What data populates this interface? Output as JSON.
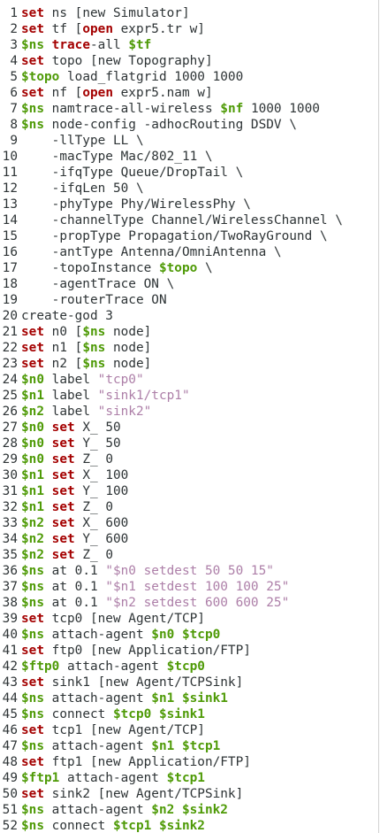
{
  "colors": {
    "keyword": "#a40000",
    "variable": "#4e9a06",
    "string": "#ad7fa8",
    "text": "#2e3436",
    "background": "#ffffff"
  },
  "lines": [
    {
      "n": "1",
      "tokens": [
        {
          "t": "set",
          "c": "kw"
        },
        {
          "t": " ns [new Simulator]",
          "c": ""
        }
      ]
    },
    {
      "n": "2",
      "tokens": [
        {
          "t": "set",
          "c": "kw"
        },
        {
          "t": " tf [",
          "c": ""
        },
        {
          "t": "open",
          "c": "kw"
        },
        {
          "t": " expr5.tr w]",
          "c": ""
        }
      ]
    },
    {
      "n": "3",
      "tokens": [
        {
          "t": "$ns",
          "c": "var"
        },
        {
          "t": " ",
          "c": ""
        },
        {
          "t": "trace",
          "c": "kw"
        },
        {
          "t": "-all ",
          "c": ""
        },
        {
          "t": "$tf",
          "c": "var"
        }
      ]
    },
    {
      "n": "4",
      "tokens": [
        {
          "t": "set",
          "c": "kw"
        },
        {
          "t": " topo [new Topography]",
          "c": ""
        }
      ]
    },
    {
      "n": "5",
      "tokens": [
        {
          "t": "$topo",
          "c": "var"
        },
        {
          "t": " load_flatgrid 1000 1000",
          "c": ""
        }
      ]
    },
    {
      "n": "6",
      "tokens": [
        {
          "t": "set",
          "c": "kw"
        },
        {
          "t": " nf [",
          "c": ""
        },
        {
          "t": "open",
          "c": "kw"
        },
        {
          "t": " expr5.nam w]",
          "c": ""
        }
      ]
    },
    {
      "n": "7",
      "tokens": [
        {
          "t": "$ns",
          "c": "var"
        },
        {
          "t": " namtrace-all-wireless ",
          "c": ""
        },
        {
          "t": "$nf",
          "c": "var"
        },
        {
          "t": " 1000 1000",
          "c": ""
        }
      ]
    },
    {
      "n": "8",
      "tokens": [
        {
          "t": "$ns",
          "c": "var"
        },
        {
          "t": " node-config -adhocRouting DSDV \\",
          "c": ""
        }
      ]
    },
    {
      "n": "9",
      "tokens": [
        {
          "t": "    -llType LL \\",
          "c": ""
        }
      ]
    },
    {
      "n": "10",
      "tokens": [
        {
          "t": "    -macType Mac/802_11 \\",
          "c": ""
        }
      ]
    },
    {
      "n": "11",
      "tokens": [
        {
          "t": "    -ifqType Queue/DropTail \\",
          "c": ""
        }
      ]
    },
    {
      "n": "12",
      "tokens": [
        {
          "t": "    -ifqLen 50 \\",
          "c": ""
        }
      ]
    },
    {
      "n": "13",
      "tokens": [
        {
          "t": "    -phyType Phy/WirelessPhy \\",
          "c": ""
        }
      ]
    },
    {
      "n": "14",
      "tokens": [
        {
          "t": "    -channelType Channel/WirelessChannel \\",
          "c": ""
        }
      ]
    },
    {
      "n": "15",
      "tokens": [
        {
          "t": "    -propType Propagation/TwoRayGround \\",
          "c": ""
        }
      ]
    },
    {
      "n": "16",
      "tokens": [
        {
          "t": "    -antType Antenna/OmniAntenna \\",
          "c": ""
        }
      ]
    },
    {
      "n": "17",
      "tokens": [
        {
          "t": "    -topoInstance ",
          "c": ""
        },
        {
          "t": "$topo",
          "c": "var"
        },
        {
          "t": " \\",
          "c": ""
        }
      ]
    },
    {
      "n": "18",
      "tokens": [
        {
          "t": "    -agentTrace ON \\",
          "c": ""
        }
      ]
    },
    {
      "n": "19",
      "tokens": [
        {
          "t": "    -routerTrace ON",
          "c": ""
        }
      ]
    },
    {
      "n": "20",
      "tokens": [
        {
          "t": "create-god 3",
          "c": ""
        }
      ]
    },
    {
      "n": "21",
      "tokens": [
        {
          "t": "set",
          "c": "kw"
        },
        {
          "t": " n0 [",
          "c": ""
        },
        {
          "t": "$ns",
          "c": "var"
        },
        {
          "t": " node]",
          "c": ""
        }
      ]
    },
    {
      "n": "22",
      "tokens": [
        {
          "t": "set",
          "c": "kw"
        },
        {
          "t": " n1 [",
          "c": ""
        },
        {
          "t": "$ns",
          "c": "var"
        },
        {
          "t": " node]",
          "c": ""
        }
      ]
    },
    {
      "n": "23",
      "tokens": [
        {
          "t": "set",
          "c": "kw"
        },
        {
          "t": " n2 [",
          "c": ""
        },
        {
          "t": "$ns",
          "c": "var"
        },
        {
          "t": " node]",
          "c": ""
        }
      ]
    },
    {
      "n": "24",
      "tokens": [
        {
          "t": "$n0",
          "c": "var"
        },
        {
          "t": " label ",
          "c": ""
        },
        {
          "t": "\"tcp0\"",
          "c": "str"
        }
      ]
    },
    {
      "n": "25",
      "tokens": [
        {
          "t": "$n1",
          "c": "var"
        },
        {
          "t": " label ",
          "c": ""
        },
        {
          "t": "\"sink1/tcp1\"",
          "c": "str"
        }
      ]
    },
    {
      "n": "26",
      "tokens": [
        {
          "t": "$n2",
          "c": "var"
        },
        {
          "t": " label ",
          "c": ""
        },
        {
          "t": "\"sink2\"",
          "c": "str"
        }
      ]
    },
    {
      "n": "27",
      "tokens": [
        {
          "t": "$n0",
          "c": "var"
        },
        {
          "t": " ",
          "c": ""
        },
        {
          "t": "set",
          "c": "kw"
        },
        {
          "t": " X_ 50",
          "c": ""
        }
      ]
    },
    {
      "n": "28",
      "tokens": [
        {
          "t": "$n0",
          "c": "var"
        },
        {
          "t": " ",
          "c": ""
        },
        {
          "t": "set",
          "c": "kw"
        },
        {
          "t": " Y_ 50",
          "c": ""
        }
      ]
    },
    {
      "n": "29",
      "tokens": [
        {
          "t": "$n0",
          "c": "var"
        },
        {
          "t": " ",
          "c": ""
        },
        {
          "t": "set",
          "c": "kw"
        },
        {
          "t": " Z_ 0",
          "c": ""
        }
      ]
    },
    {
      "n": "30",
      "tokens": [
        {
          "t": "$n1",
          "c": "var"
        },
        {
          "t": " ",
          "c": ""
        },
        {
          "t": "set",
          "c": "kw"
        },
        {
          "t": " X_ 100",
          "c": ""
        }
      ]
    },
    {
      "n": "31",
      "tokens": [
        {
          "t": "$n1",
          "c": "var"
        },
        {
          "t": " ",
          "c": ""
        },
        {
          "t": "set",
          "c": "kw"
        },
        {
          "t": " Y_ 100",
          "c": ""
        }
      ]
    },
    {
      "n": "32",
      "tokens": [
        {
          "t": "$n1",
          "c": "var"
        },
        {
          "t": " ",
          "c": ""
        },
        {
          "t": "set",
          "c": "kw"
        },
        {
          "t": " Z_ 0",
          "c": ""
        }
      ]
    },
    {
      "n": "33",
      "tokens": [
        {
          "t": "$n2",
          "c": "var"
        },
        {
          "t": " ",
          "c": ""
        },
        {
          "t": "set",
          "c": "kw"
        },
        {
          "t": " X_ 600",
          "c": ""
        }
      ]
    },
    {
      "n": "34",
      "tokens": [
        {
          "t": "$n2",
          "c": "var"
        },
        {
          "t": " ",
          "c": ""
        },
        {
          "t": "set",
          "c": "kw"
        },
        {
          "t": " Y_ 600",
          "c": ""
        }
      ]
    },
    {
      "n": "35",
      "tokens": [
        {
          "t": "$n2",
          "c": "var"
        },
        {
          "t": " ",
          "c": ""
        },
        {
          "t": "set",
          "c": "kw"
        },
        {
          "t": " Z_ 0",
          "c": ""
        }
      ]
    },
    {
      "n": "36",
      "tokens": [
        {
          "t": "$ns",
          "c": "var"
        },
        {
          "t": " at 0.1 ",
          "c": ""
        },
        {
          "t": "\"$n0 setdest 50 50 15\"",
          "c": "str"
        }
      ]
    },
    {
      "n": "37",
      "tokens": [
        {
          "t": "$ns",
          "c": "var"
        },
        {
          "t": " at 0.1 ",
          "c": ""
        },
        {
          "t": "\"$n1 setdest 100 100 25\"",
          "c": "str"
        }
      ]
    },
    {
      "n": "38",
      "tokens": [
        {
          "t": "$ns",
          "c": "var"
        },
        {
          "t": " at 0.1 ",
          "c": ""
        },
        {
          "t": "\"$n2 setdest 600 600 25\"",
          "c": "str"
        }
      ]
    },
    {
      "n": "39",
      "tokens": [
        {
          "t": "set",
          "c": "kw"
        },
        {
          "t": " tcp0 [new Agent/TCP]",
          "c": ""
        }
      ]
    },
    {
      "n": "40",
      "tokens": [
        {
          "t": "$ns",
          "c": "var"
        },
        {
          "t": " attach-agent ",
          "c": ""
        },
        {
          "t": "$n0",
          "c": "var"
        },
        {
          "t": " ",
          "c": ""
        },
        {
          "t": "$tcp0",
          "c": "var"
        }
      ]
    },
    {
      "n": "41",
      "tokens": [
        {
          "t": "set",
          "c": "kw"
        },
        {
          "t": " ftp0 [new Application/FTP]",
          "c": ""
        }
      ]
    },
    {
      "n": "42",
      "tokens": [
        {
          "t": "$ftp0",
          "c": "var"
        },
        {
          "t": " attach-agent ",
          "c": ""
        },
        {
          "t": "$tcp0",
          "c": "var"
        }
      ]
    },
    {
      "n": "43",
      "tokens": [
        {
          "t": "set",
          "c": "kw"
        },
        {
          "t": " sink1 [new Agent/TCPSink]",
          "c": ""
        }
      ]
    },
    {
      "n": "44",
      "tokens": [
        {
          "t": "$ns",
          "c": "var"
        },
        {
          "t": " attach-agent ",
          "c": ""
        },
        {
          "t": "$n1",
          "c": "var"
        },
        {
          "t": " ",
          "c": ""
        },
        {
          "t": "$sink1",
          "c": "var"
        }
      ]
    },
    {
      "n": "45",
      "tokens": [
        {
          "t": "$ns",
          "c": "var"
        },
        {
          "t": " connect ",
          "c": ""
        },
        {
          "t": "$tcp0",
          "c": "var"
        },
        {
          "t": " ",
          "c": ""
        },
        {
          "t": "$sink1",
          "c": "var"
        }
      ]
    },
    {
      "n": "46",
      "tokens": [
        {
          "t": "set",
          "c": "kw"
        },
        {
          "t": " tcp1 [new Agent/TCP]",
          "c": ""
        }
      ]
    },
    {
      "n": "47",
      "tokens": [
        {
          "t": "$ns",
          "c": "var"
        },
        {
          "t": " attach-agent ",
          "c": ""
        },
        {
          "t": "$n1",
          "c": "var"
        },
        {
          "t": " ",
          "c": ""
        },
        {
          "t": "$tcp1",
          "c": "var"
        }
      ]
    },
    {
      "n": "48",
      "tokens": [
        {
          "t": "set",
          "c": "kw"
        },
        {
          "t": " ftp1 [new Application/FTP]",
          "c": ""
        }
      ]
    },
    {
      "n": "49",
      "tokens": [
        {
          "t": "$ftp1",
          "c": "var"
        },
        {
          "t": " attach-agent ",
          "c": ""
        },
        {
          "t": "$tcp1",
          "c": "var"
        }
      ]
    },
    {
      "n": "50",
      "tokens": [
        {
          "t": "set",
          "c": "kw"
        },
        {
          "t": " sink2 [new Agent/TCPSink]",
          "c": ""
        }
      ]
    },
    {
      "n": "51",
      "tokens": [
        {
          "t": "$ns",
          "c": "var"
        },
        {
          "t": " attach-agent ",
          "c": ""
        },
        {
          "t": "$n2",
          "c": "var"
        },
        {
          "t": " ",
          "c": ""
        },
        {
          "t": "$sink2",
          "c": "var"
        }
      ]
    },
    {
      "n": "52",
      "tokens": [
        {
          "t": "$ns",
          "c": "var"
        },
        {
          "t": " connect ",
          "c": ""
        },
        {
          "t": "$tcp1",
          "c": "var"
        },
        {
          "t": " ",
          "c": ""
        },
        {
          "t": "$sink2",
          "c": "var"
        }
      ]
    }
  ]
}
